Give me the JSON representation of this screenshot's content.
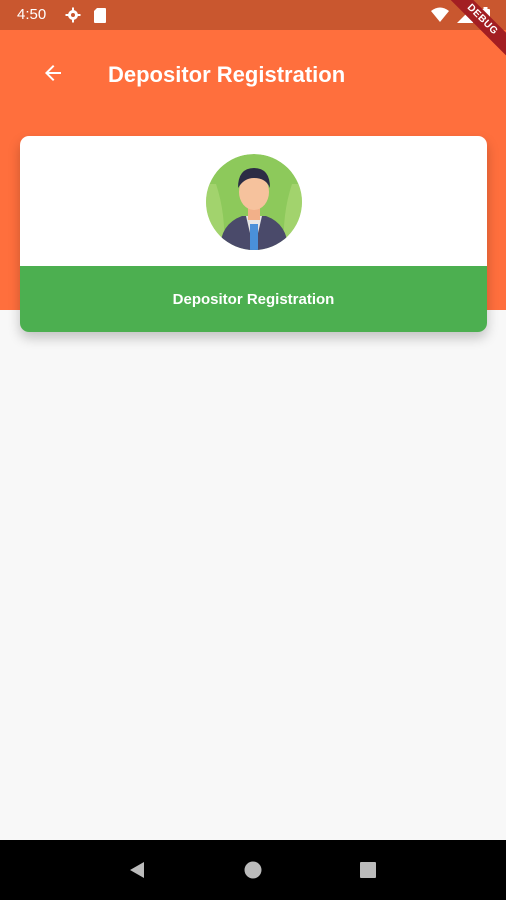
{
  "status_bar": {
    "time": "4:50",
    "icons_left": [
      "settings-icon",
      "sd-card-icon"
    ],
    "icons_right": [
      "wifi-icon",
      "signal-icon",
      "battery-icon"
    ],
    "debug_label": "DEBUG"
  },
  "header": {
    "title": "Depositor Registration",
    "back_icon": "arrow-back-icon"
  },
  "card": {
    "avatar_icon": "user-avatar-icon",
    "action_label": "Depositor Registration"
  },
  "nav_bar": {
    "buttons": [
      "back-triangle-icon",
      "home-circle-icon",
      "recents-square-icon"
    ]
  },
  "colors": {
    "status_bar": "#c9572f",
    "header": "#ff6f3d",
    "action": "#4caf50",
    "background": "#f8f8f8"
  }
}
